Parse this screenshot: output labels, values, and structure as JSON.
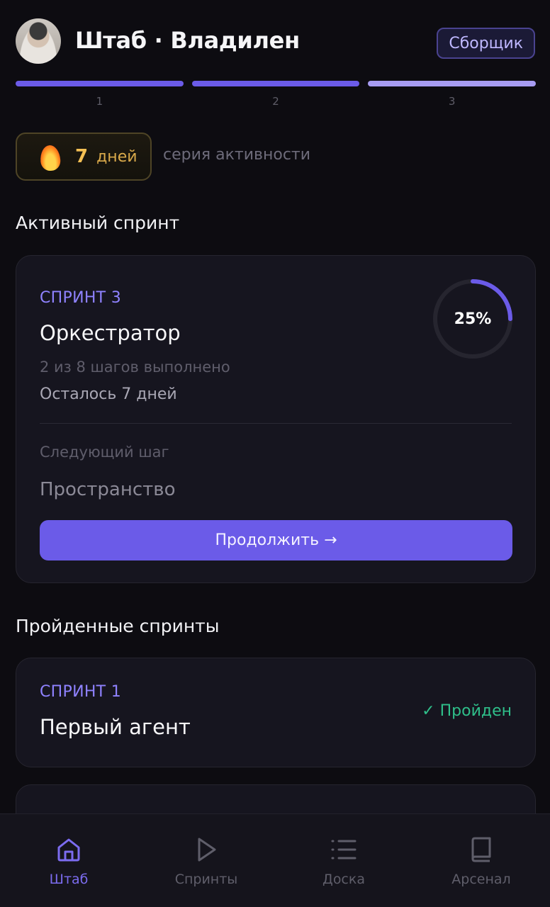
{
  "header": {
    "title": "Штаб · Владилен",
    "role_badge": "Сборщик"
  },
  "steps": [
    {
      "label": "1",
      "state": "done"
    },
    {
      "label": "2",
      "state": "done"
    },
    {
      "label": "3",
      "state": "current"
    }
  ],
  "streak": {
    "count": "7",
    "unit": "дней",
    "caption": "серия активности"
  },
  "active_section": {
    "title": "Активный спринт",
    "sprint": {
      "eyebrow": "СПРИНТ 3",
      "name": "Оркестратор",
      "progress_text": "2 из 8 шагов выполнено",
      "remaining": "Осталось 7 дней",
      "percent_label": "25%",
      "percent": 0.25,
      "next_step_label": "Следующий шаг",
      "next_step": "Пространство",
      "continue_label": "Продолжить →"
    }
  },
  "completed_section": {
    "title": "Пройденные спринты",
    "items": [
      {
        "eyebrow": "СПРИНТ 1",
        "name": "Первый агент",
        "status": "✓ Пройден"
      }
    ]
  },
  "nav": {
    "items": [
      {
        "label": "Штаб",
        "icon": "home-icon",
        "active": true
      },
      {
        "label": "Спринты",
        "icon": "play-icon",
        "active": false
      },
      {
        "label": "Доска",
        "icon": "list-icon",
        "active": false
      },
      {
        "label": "Арсенал",
        "icon": "book-icon",
        "active": false
      }
    ]
  },
  "colors": {
    "accent": "#6b5be8",
    "success": "#2fbf8a",
    "streak": "#f5c054",
    "background": "#0d0c11"
  }
}
